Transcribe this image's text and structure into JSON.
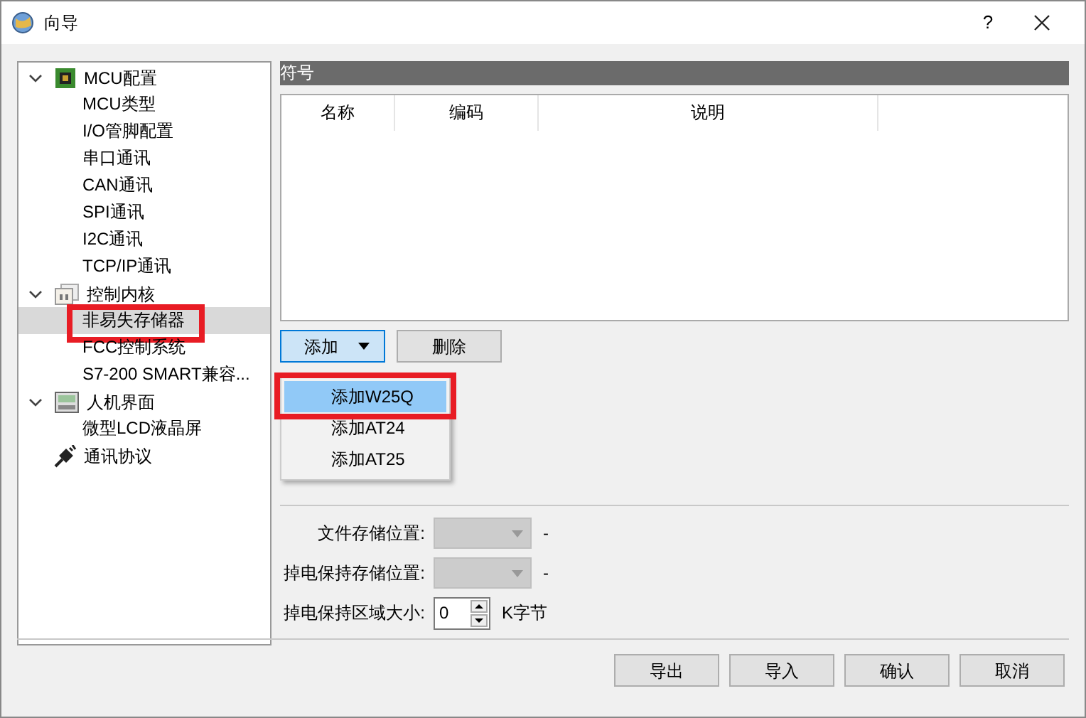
{
  "window": {
    "title": "向导",
    "help": "?"
  },
  "tree": [
    {
      "label": "MCU配置",
      "kind": "chip",
      "expanded": true,
      "selected": false,
      "children": [
        {
          "label": "MCU类型",
          "selected": false
        },
        {
          "label": "I/O管脚配置",
          "selected": false
        },
        {
          "label": "串口通讯",
          "selected": false
        },
        {
          "label": "CAN通讯",
          "selected": false
        },
        {
          "label": "SPI通讯",
          "selected": false
        },
        {
          "label": "I2C通讯",
          "selected": false
        },
        {
          "label": "TCP/IP通讯",
          "selected": false
        }
      ]
    },
    {
      "label": "控制内核",
      "kind": "core",
      "expanded": true,
      "selected": false,
      "children": [
        {
          "label": "非易失存储器",
          "selected": true,
          "highlighted": true
        },
        {
          "label": "FCC控制系统",
          "selected": false
        },
        {
          "label": "S7-200 SMART兼容...",
          "selected": false
        }
      ]
    },
    {
      "label": "人机界面",
      "kind": "hmi",
      "expanded": true,
      "selected": false,
      "children": [
        {
          "label": "微型LCD液晶屏",
          "selected": false
        }
      ]
    },
    {
      "label": "通讯协议",
      "kind": "plug",
      "selected": false
    }
  ],
  "section_title": "符号",
  "table": {
    "columns": [
      "名称",
      "编码",
      "说明"
    ]
  },
  "add_button": {
    "label": "添加"
  },
  "delete_button": {
    "label": "删除"
  },
  "add_menu": [
    {
      "label": "添加W25Q",
      "selected": true,
      "highlighted": true
    },
    {
      "label": "添加AT24",
      "selected": false
    },
    {
      "label": "添加AT25",
      "selected": false
    }
  ],
  "form": [
    {
      "label": "文件存储位置:",
      "kind": "combo",
      "suffix": "-",
      "disabled": true
    },
    {
      "label": "掉电保持存储位置:",
      "kind": "combo",
      "suffix": "-",
      "disabled": true
    },
    {
      "label": "掉电保持区域大小:",
      "kind": "spin",
      "value": "0",
      "suffix": "K字节"
    }
  ],
  "buttons": [
    "导出",
    "导入",
    "确认",
    "取消"
  ]
}
